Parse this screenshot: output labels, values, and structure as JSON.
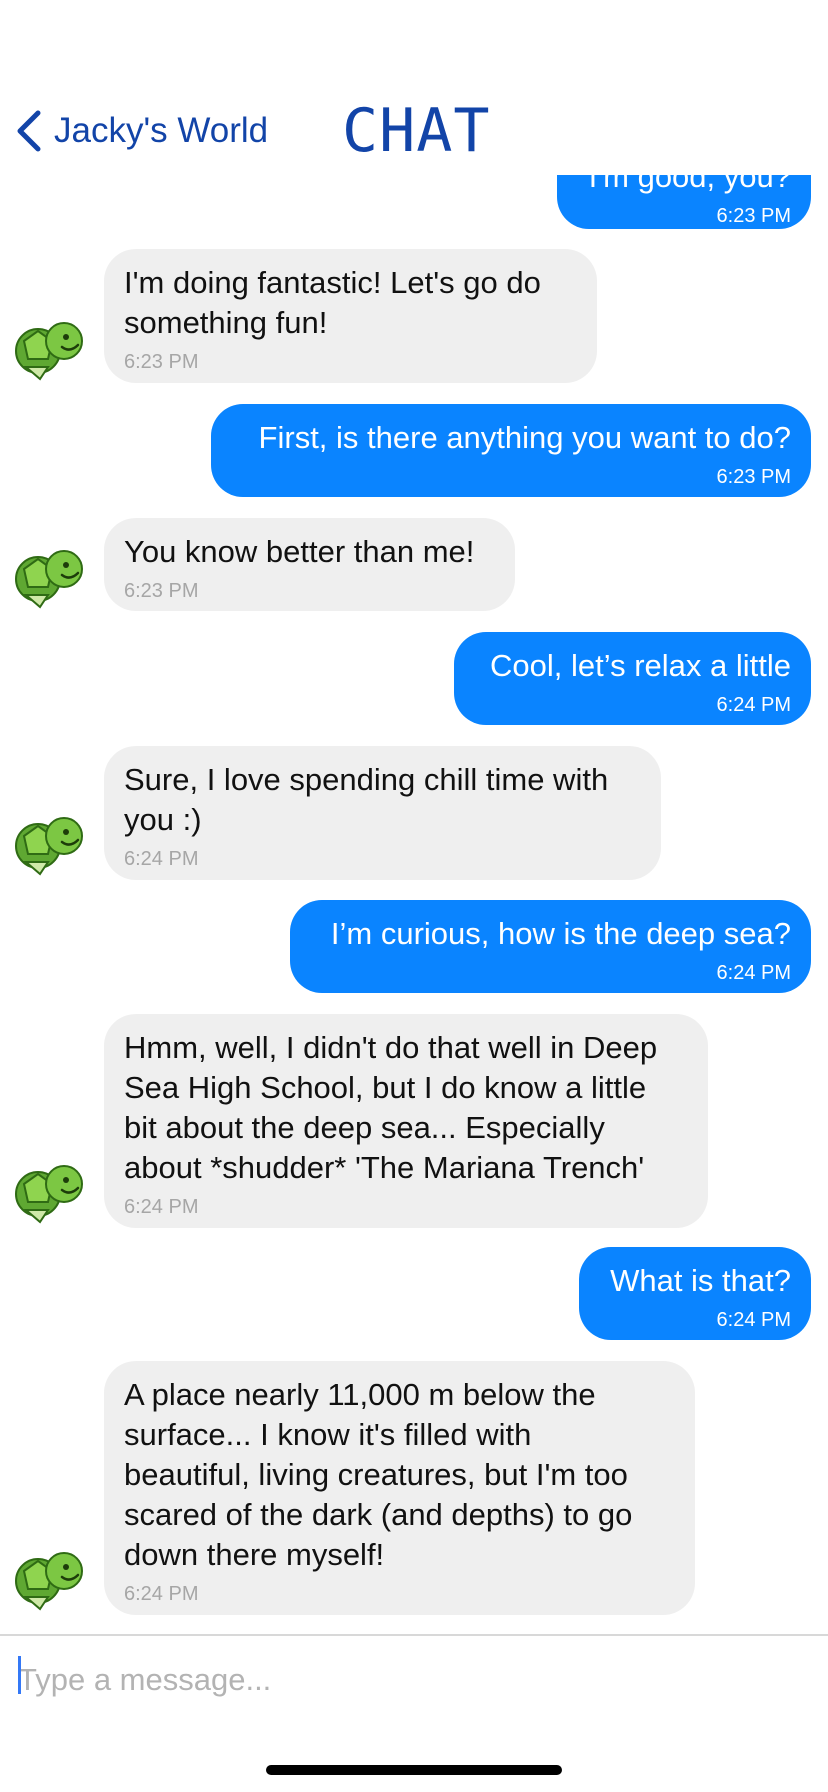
{
  "header": {
    "back_label": "Jacky's World",
    "title": "CHAT"
  },
  "messages": [
    {
      "from": "me",
      "text": "I'm good, you?",
      "time": "6:23 PM"
    },
    {
      "from": "them",
      "lines": [
        "I'm doing fantastic! Let's go do",
        "something fun!"
      ],
      "time": "6:23 PM"
    },
    {
      "from": "me",
      "text": "First, is there anything you want to do?",
      "time": "6:23 PM"
    },
    {
      "from": "them",
      "lines": [
        "You know better than me!"
      ],
      "time": "6:23 PM"
    },
    {
      "from": "me",
      "text": "Cool, let’s relax a little",
      "time": "6:24 PM"
    },
    {
      "from": "them",
      "lines": [
        "Sure, I love spending chill time with",
        "you :)"
      ],
      "time": "6:24 PM"
    },
    {
      "from": "me",
      "text": "I’m curious, how is the deep sea?",
      "time": "6:24 PM"
    },
    {
      "from": "them",
      "lines": [
        "Hmm, well, I didn't do that well in Deep",
        "Sea High School, but I do know a little",
        "bit about the deep sea... Especially",
        "about *shudder* 'The Mariana Trench'"
      ],
      "time": "6:24 PM"
    },
    {
      "from": "me",
      "text": "What is that?",
      "time": "6:24 PM"
    },
    {
      "from": "them",
      "lines": [
        "A place nearly 11,000 m below the",
        "surface... I know it's filled with",
        "beautiful, living creatures, but I'm too",
        "scared of the dark (and depths) to go",
        "down there myself!"
      ],
      "time": "6:24 PM"
    }
  ],
  "composer": {
    "placeholder": "Type a message..."
  },
  "colors": {
    "accent": "#1244a8",
    "outgoing_bubble": "#0a84ff",
    "incoming_bubble": "#efefef",
    "avatar_green": "#6cb33f"
  },
  "icons": {
    "back": "chevron-left-icon",
    "avatar": "turtle-avatar-icon"
  }
}
